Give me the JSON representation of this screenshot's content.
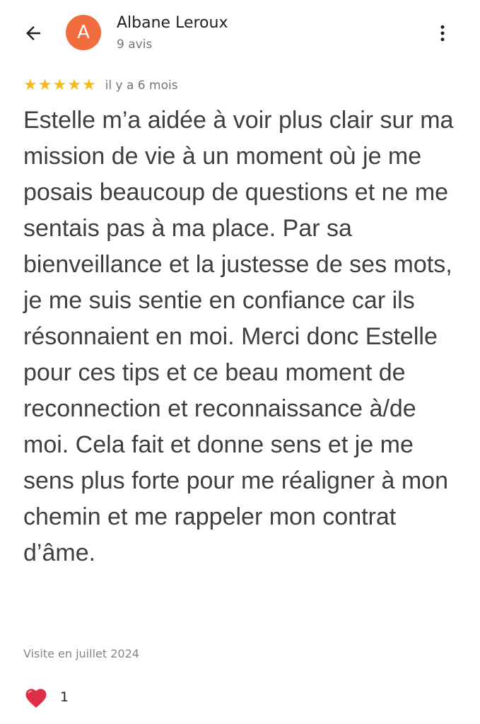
{
  "header": {
    "avatar_letter": "A",
    "author_name": "Albane Leroux",
    "review_count": "9 avis",
    "avatar_color": "#f26d3d"
  },
  "review": {
    "rating": 5,
    "max_rating": 5,
    "star_color": "#f6bb19",
    "relative_date": "il y a 6 mois",
    "text": "Estelle m’a aidée à voir plus clair sur ma mission de vie à un moment où je me posais beaucoup de questions et ne me sentais pas à ma place. Par sa bienveillance et la justesse de ses mots, je me suis sentie en confiance car ils résonnaient en moi. Merci donc Estelle pour ces tips et ce beau moment de reconnection et reconnaissance à/de moi. Cela fait et donne sens et je me sens plus forte pour me réaligner à mon chemin et me rappeler mon contrat d’âme.",
    "visit_date": "Visite en juillet 2024"
  },
  "reactions": {
    "icon": "heart-icon",
    "count": "1"
  },
  "icons": {
    "back": "back-arrow-icon",
    "more": "more-vertical-icon"
  }
}
